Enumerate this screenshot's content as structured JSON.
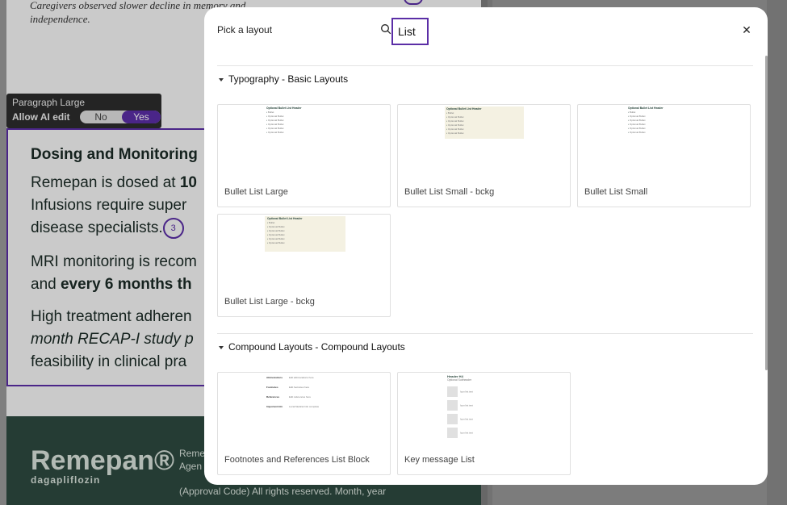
{
  "background": {
    "caption": "Caregivers observed slower decline in memory and independence.",
    "paragraph_toolbar": {
      "title": "Paragraph Large",
      "ai_label": "Allow AI edit",
      "no": "No",
      "yes": "Yes"
    },
    "content": {
      "heading": "Dosing and Monitoring",
      "line1_pre": "Remepan is dosed at ",
      "line1_bold": "10",
      "line2": "Infusions require super",
      "line3": "disease specialists.",
      "citation": "3",
      "line4": "MRI monitoring is recom",
      "line5_pre": "and ",
      "line5_bold": "every 6 months th",
      "line6": "High treatment adheren",
      "line7_italic": "month RECAP-I study p",
      "line8": "feasibility in clinical pra"
    },
    "footer": {
      "brand": "Remepan®",
      "generic": "dagapliflozin",
      "company_line1": "Reme",
      "company_line2": "Agen",
      "approval": "(Approval Code) All rights reserved. Month, year"
    }
  },
  "modal": {
    "title": "Pick a layout",
    "search_value": "List",
    "sections": [
      {
        "title": "Typography - Basic Layouts",
        "cards": [
          {
            "label": "Bullet List Large",
            "thumb_title": "Optional Bullet List Header",
            "items": [
              "Bullet",
              "Optional Bullet",
              "Optional Bullet",
              "Optional Bullet",
              "Optional Bullet",
              "Optional Bullet"
            ]
          },
          {
            "label": "Bullet List Small - bckg",
            "thumb_title": "Optional Bullet List Header",
            "items": [
              "Bullet",
              "Optional Bullet",
              "Optional Bullet",
              "Optional Bullet",
              "Optional Bullet",
              "Optional Bullet"
            ]
          },
          {
            "label": "Bullet List Small",
            "thumb_title": "Optional Bullet List Header",
            "items": [
              "Bullet",
              "Optional Bullet",
              "Optional Bullet",
              "Optional Bullet",
              "Optional Bullet",
              "Optional Bullet"
            ]
          },
          {
            "label": "Bullet List Large - bckg",
            "thumb_title": "Optional Bullet List Header",
            "items": [
              "Bullet",
              "Optional Bullet",
              "Optional Bullet",
              "Optional Bullet",
              "Optional Bullet",
              "Optional Bullet"
            ]
          }
        ]
      },
      {
        "title": "Compound Layouts - Compound Layouts",
        "cards": [
          {
            "label": "Footnotes and References List Block",
            "rows": [
              {
                "k": "Abbreviations",
                "v": "Edit abbreviations here"
              },
              {
                "k": "Footnotes",
                "v": "Edit footnotes here"
              },
              {
                "k": "References",
                "v": "Edit references here"
              },
              {
                "k": "Important Info",
                "v": "Local Medical Info complete"
              }
            ]
          },
          {
            "label": "Key message List",
            "header": "Header H4",
            "subheader": "Optional Subheader",
            "items": [
              "Icon list text",
              "Icon list text",
              "Icon list text",
              "Icon list text"
            ]
          }
        ]
      }
    ]
  }
}
